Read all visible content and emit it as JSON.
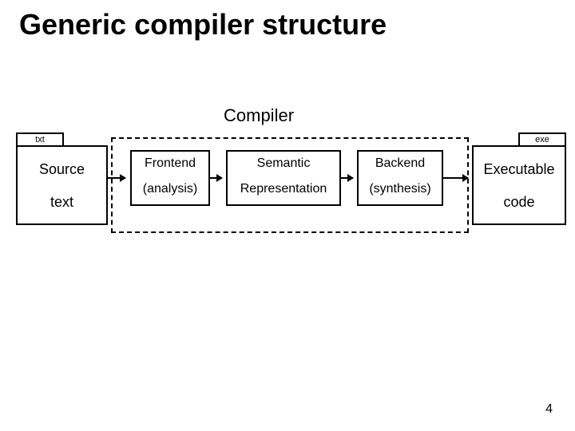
{
  "title": "Generic compiler structure",
  "compiler_label": "Compiler",
  "source": {
    "tag": "txt",
    "line1": "Source",
    "line2": "text"
  },
  "frontend": {
    "line1": "Frontend",
    "line2": "(analysis)"
  },
  "semantic": {
    "line1": "Semantic",
    "line2": "Representation"
  },
  "backend": {
    "line1": "Backend",
    "line2": "(synthesis)"
  },
  "executable": {
    "tag": "exe",
    "line1": "Executable",
    "line2": "code"
  },
  "page_number": "4"
}
